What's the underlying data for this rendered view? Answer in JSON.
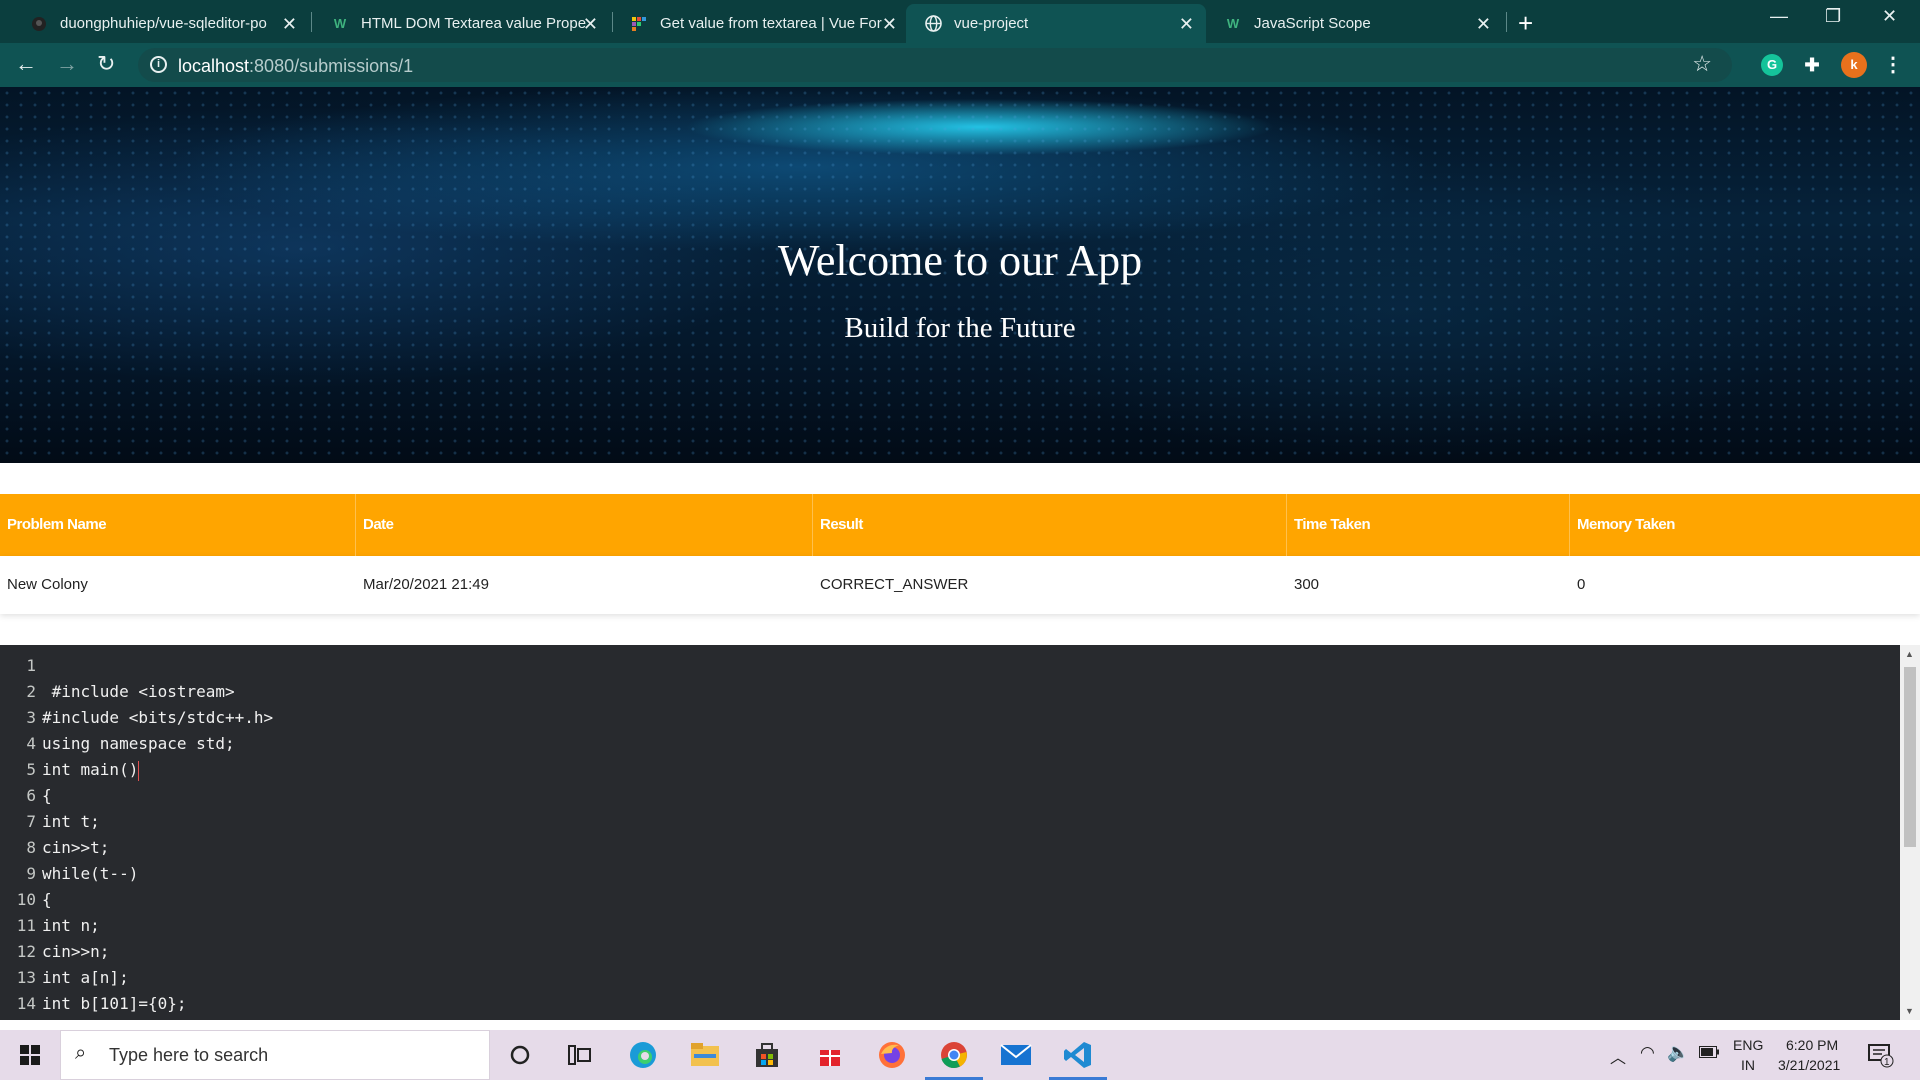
{
  "browser": {
    "tabs": [
      {
        "title": "duongphuhiep/vue-sqleditor-po",
        "icon": "github-icon",
        "active": false
      },
      {
        "title": "HTML DOM Textarea value Prope",
        "icon": "w3schools-icon",
        "active": false
      },
      {
        "title": "Get value from textarea | Vue For",
        "icon": "vue-forum-icon",
        "active": false
      },
      {
        "title": "vue-project",
        "icon": "globe-icon",
        "active": true
      },
      {
        "title": "JavaScript Scope",
        "icon": "w3schools-icon",
        "active": false
      }
    ],
    "url_host": "localhost",
    "url_path": ":8080/submissions/1",
    "profile_initial": "k",
    "grammarly_initial": "G"
  },
  "hero": {
    "title": "Welcome to our App",
    "subtitle": "Build for the Future"
  },
  "table": {
    "headers": [
      "Problem Name",
      "Date",
      "Result",
      "Time Taken",
      "Memory Taken"
    ],
    "rows": [
      [
        "New Colony",
        "Mar/20/2021 21:49",
        "CORRECT_ANSWER",
        "300",
        "0"
      ]
    ]
  },
  "editor": {
    "line_numbers": [
      "1",
      "2",
      "3",
      "4",
      "5",
      "6",
      "7",
      "8",
      "9",
      "10",
      "11",
      "12",
      "13",
      "14"
    ],
    "lines": [
      "",
      " #include <iostream>",
      "#include <bits/stdc++.h>",
      "using namespace std;",
      "int main()",
      "{",
      "int t;",
      "cin>>t;",
      "while(t--)",
      "{",
      "int n;",
      "cin>>n;",
      "int a[n];",
      "int b[101]={0};"
    ]
  },
  "taskbar": {
    "search_placeholder": "Type here to search",
    "language": "ENG",
    "region": "IN",
    "time": "6:20 PM",
    "date": "3/21/2021",
    "notification_count": "1"
  },
  "colors": {
    "table_header": "#ffa500",
    "editor_bg": "#282a2e",
    "chrome_dark": "#0b3e3e",
    "chrome_toolbar": "#0f5353"
  }
}
